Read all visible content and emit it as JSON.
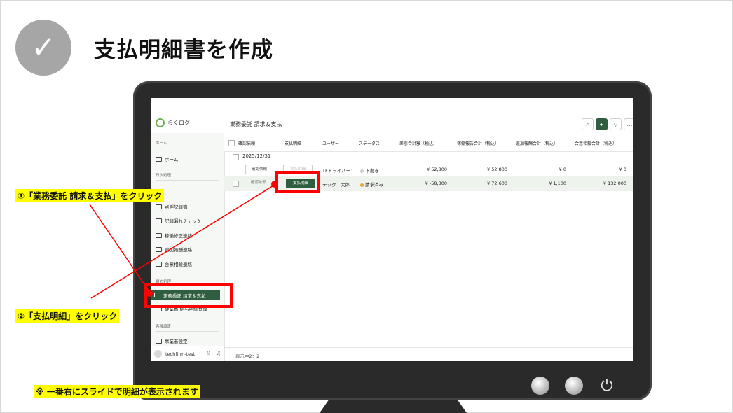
{
  "heading": {
    "title": "支払明細書を作成",
    "check_icon": "✓"
  },
  "app": {
    "logo_text": "らくログ",
    "page_title": "業務委託 請求＆支払",
    "toolbar": {
      "search_icon": "⌕",
      "add_icon": "+",
      "filter_icon": "▽",
      "more_icon": "…"
    }
  },
  "sidebar": {
    "home_section": "ホーム",
    "home": "ホーム",
    "daily_section": "日次処理",
    "items": [
      "点呼記録簿",
      "記録漏れチェック",
      "稼働修正連絡",
      "追加報酬連絡",
      "合意相殺連絡"
    ],
    "monthly_section": "締め処理",
    "active_item": "業務委託 請求＆支払",
    "next_item": "従業員 給与明細登録",
    "settings_section": "各種設定",
    "settings_item": "事業者設定",
    "user": "techfirm-test"
  },
  "grid": {
    "columns": [
      "確認依頼",
      "支払明細",
      "ユーザー",
      "ステータス",
      "差引合計額（税込）",
      "稼働報告合計（税込）",
      "追加報酬合計（税込）",
      "合意相殺合計（税込）"
    ],
    "group": "2025/12/31",
    "rows": [
      {
        "confirm": "確認依頼",
        "pay": "支払明細",
        "user": "TFドライバー1",
        "status": "下書き",
        "net": "¥ 52,800",
        "work": "¥ 52,800",
        "extra": "¥ 0",
        "offset": "¥ 0"
      },
      {
        "confirm": "確認依頼",
        "pay": "支払明細",
        "user": "テック　太郎",
        "status": "請求済み",
        "net": "¥ -58,300",
        "work": "¥ 72,600",
        "extra": "¥ 1,100",
        "offset": "¥ 132,000"
      }
    ],
    "footer": "表示中2：2"
  },
  "annotations": {
    "step1": "①「業務委託 請求＆支払」をクリック",
    "step2": "②「支払明細」をクリック",
    "note": "※ 一番右にスライドで明細が表示されます",
    "highlight_color": "#ff0000",
    "note_bg": "#ffff00"
  },
  "colors": {
    "accent": "#2e5e3f",
    "monitor": "#2a2a2a",
    "check_circle": "#a6a6a6"
  }
}
